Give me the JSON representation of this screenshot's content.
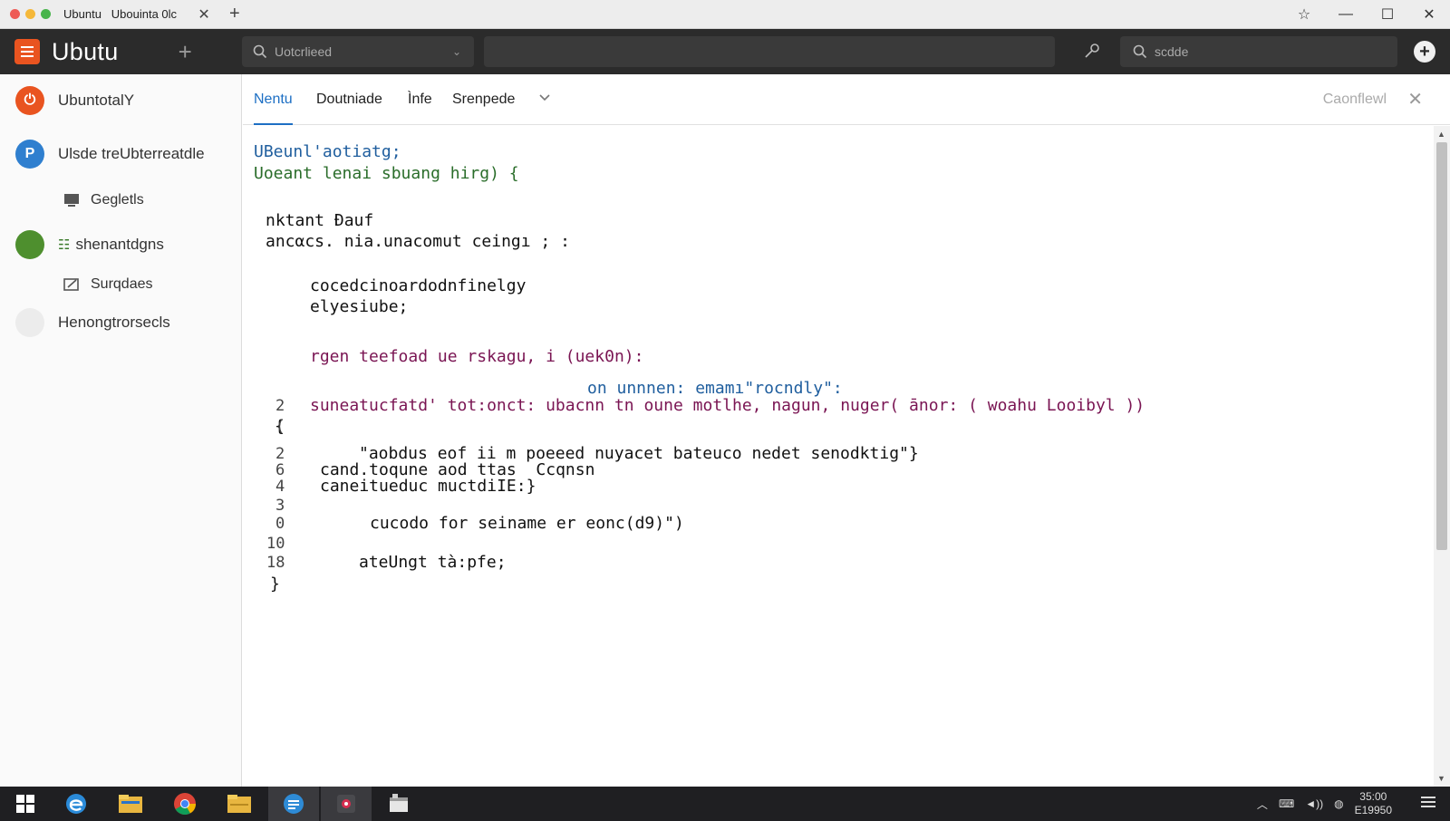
{
  "window": {
    "tab_title": "Ubuntu   Ubouinta 0lc",
    "controls": [
      "pin",
      "minimize",
      "maximize",
      "close"
    ]
  },
  "appbar": {
    "name": "Ubutu",
    "search_value": "Uotcrlieed",
    "right_search_value": "scdde",
    "brand_color": "#e95420"
  },
  "sidebar": {
    "items": [
      {
        "label": "UbuntotalY",
        "icon": "power-icon",
        "color": "#e95420"
      },
      {
        "label": "Ulsde treUbterreatdle",
        "icon": "p-icon",
        "color": "#2f7fcf"
      },
      {
        "label": "Gegletls",
        "icon": "monitor-icon"
      },
      {
        "label": "shenantdgns",
        "icon": "grid-icon",
        "color": "#4e8f2e"
      },
      {
        "label": "Surqdaes",
        "icon": "edit-icon"
      },
      {
        "label": "Henongtrorsecls",
        "icon": "blank-circle-icon",
        "color": "#eeeeee"
      }
    ]
  },
  "tabs": {
    "items": [
      "Nentu",
      "Doutniade",
      "Ìnfe",
      "Srenpede"
    ],
    "active": "Nentu",
    "right_label": "Caonflewl"
  },
  "code": {
    "lines": [
      "UBeunl'aotiatg;",
      "Uoeant lenai sbuang hirg) {",
      "nktant Ðauf",
      "ancαcs. nia.unacomut ceingı ; :",
      "cocedcinoardodnfinelgy",
      "elyesiube;",
      "rgen teefoad ue rskagu, i (uek0n):",
      "on unnnen: emamı\"rocndly\":",
      "suneatucfatd' tot:onct: ubacnn tn oune motlhe, nagun, nuger( ānor: ( woahu Looibyl ))",
      "{",
      "\"aobdus eof ii m poeeed nuyacet bateuco nedet senodktig\"}",
      "cand.toqune aod ttas  Ccqnsn",
      "caneitueduc muctdiIE:}",
      "cucodo for seiname er eonc(d9)\")",
      "ateUngt tà:pfe;",
      "}"
    ],
    "line_numbers": [
      "2",
      "(",
      "2",
      "6",
      "4",
      "3",
      "0",
      "10",
      "18"
    ]
  },
  "taskbar": {
    "apps": [
      "windows-start-icon",
      "edge-icon",
      "file-explorer-icon",
      "chrome-icon",
      "folder-icon",
      "app-icon-blue",
      "app-icon-record",
      "app-icon-window"
    ],
    "time": "35:00",
    "date": "E19950"
  }
}
